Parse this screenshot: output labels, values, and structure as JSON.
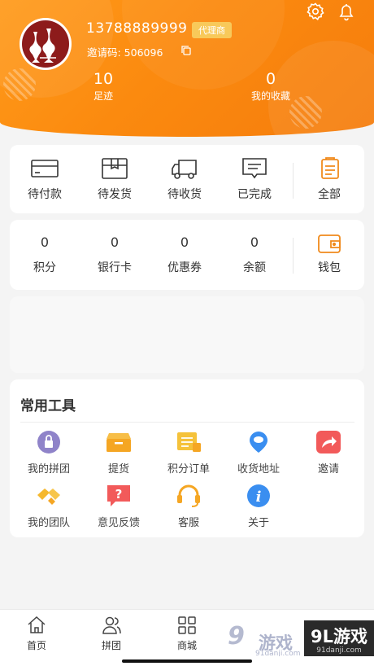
{
  "header": {
    "phone": "13788889999",
    "badge": "代理商",
    "invite_code": "邀请码: 506096",
    "stats": [
      {
        "value": "10",
        "label": "足迹"
      },
      {
        "value": "0",
        "label": "我的收藏"
      }
    ]
  },
  "orders": {
    "items": [
      {
        "label": "待付款",
        "icon": "card-icon"
      },
      {
        "label": "待发货",
        "icon": "box-icon"
      },
      {
        "label": "待收货",
        "icon": "truck-icon"
      },
      {
        "label": "已完成",
        "icon": "message-check-icon"
      }
    ],
    "all": {
      "label": "全部",
      "icon": "clipboard-icon"
    }
  },
  "account": {
    "items": [
      {
        "value": "0",
        "label": "积分"
      },
      {
        "value": "0",
        "label": "银行卡"
      },
      {
        "value": "0",
        "label": "优惠券"
      },
      {
        "value": "0",
        "label": "余额"
      }
    ],
    "wallet": {
      "label": "钱包",
      "icon": "wallet-icon"
    }
  },
  "tools": {
    "title": "常用工具",
    "items": [
      {
        "label": "我的拼团",
        "icon": "group-buy-icon",
        "color": "#8f83c9"
      },
      {
        "label": "提货",
        "icon": "pickup-box-icon",
        "color": "#f5a623"
      },
      {
        "label": "积分订单",
        "icon": "points-order-icon",
        "color": "#f5c23a"
      },
      {
        "label": "收货地址",
        "icon": "location-icon",
        "color": "#3a8ef0"
      },
      {
        "label": "邀请",
        "icon": "share-icon",
        "color": "#f25a5a"
      },
      {
        "label": "我的团队",
        "icon": "team-icon",
        "color": "#f5b82e"
      },
      {
        "label": "意见反馈",
        "icon": "feedback-icon",
        "color": "#f25a5a"
      },
      {
        "label": "客服",
        "icon": "headset-icon",
        "color": "#f5a623"
      },
      {
        "label": "关于",
        "icon": "info-icon",
        "color": "#3a8ef0"
      }
    ]
  },
  "nav": {
    "items": [
      {
        "label": "首页",
        "icon": "home-icon"
      },
      {
        "label": "拼团",
        "icon": "people-icon"
      },
      {
        "label": "商城",
        "icon": "grid-icon"
      }
    ]
  },
  "watermark": {
    "logo": "9",
    "text": "游戏",
    "url": "91danji.com",
    "box_title": "9L游戏",
    "box_url": "91danji.com"
  },
  "colors": {
    "accent": "#fb8a0f",
    "badge": "#f8c95a"
  }
}
